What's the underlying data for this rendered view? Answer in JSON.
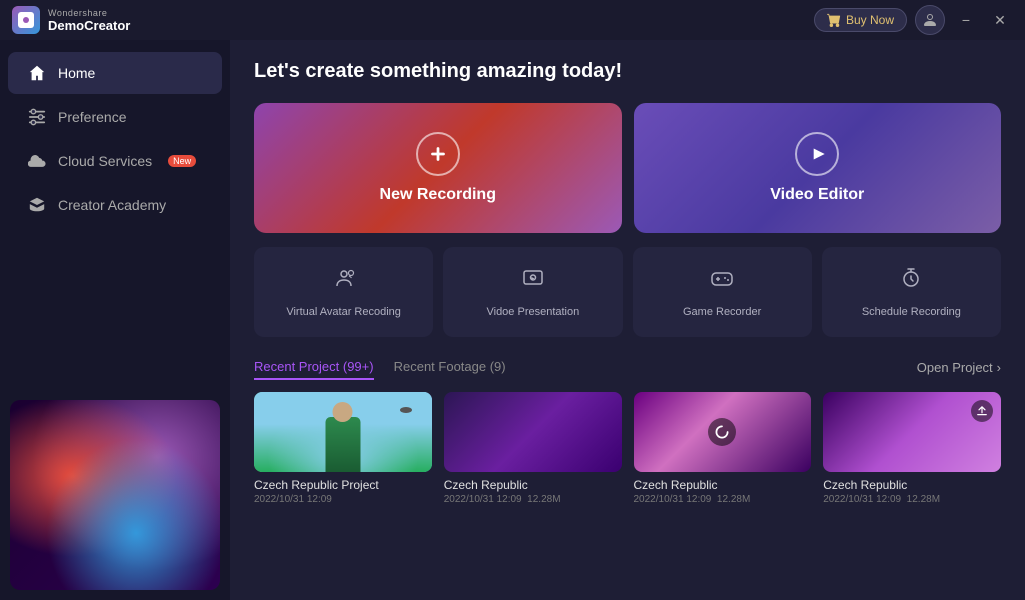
{
  "app": {
    "brand_top": "Wondershare",
    "brand_bottom": "DemoCreator"
  },
  "titlebar": {
    "buy_now_label": "Buy Now",
    "minimize_label": "−",
    "close_label": "✕"
  },
  "sidebar": {
    "items": [
      {
        "id": "home",
        "label": "Home",
        "active": true
      },
      {
        "id": "preference",
        "label": "Preference",
        "active": false
      },
      {
        "id": "cloud-services",
        "label": "Cloud Services",
        "badge": "New",
        "active": false
      },
      {
        "id": "creator-academy",
        "label": "Creator Academy",
        "active": false
      }
    ]
  },
  "content": {
    "headline": "Let's create something amazing today!",
    "cards": [
      {
        "id": "new-recording",
        "label": "New Recording"
      },
      {
        "id": "video-editor",
        "label": "Video Editor"
      }
    ],
    "features": [
      {
        "id": "virtual-avatar",
        "label": "Virtual Avatar Recoding"
      },
      {
        "id": "video-presentation",
        "label": "Vidoe Presentation"
      },
      {
        "id": "game-recorder",
        "label": "Game Recorder"
      },
      {
        "id": "schedule-recording",
        "label": "Schedule Recording"
      }
    ],
    "recent_tabs": [
      {
        "id": "recent-project",
        "label": "Recent Project (99+)",
        "active": true
      },
      {
        "id": "recent-footage",
        "label": "Recent Footage (9)",
        "active": false
      }
    ],
    "open_project_label": "Open Project",
    "projects": [
      {
        "id": "p1",
        "name": "Czech Republic Project",
        "date": "2022/10/31 12:09",
        "size": ""
      },
      {
        "id": "p2",
        "name": "Czech Republic",
        "date": "2022/10/31 12:09",
        "size": "12.28M"
      },
      {
        "id": "p3",
        "name": "Czech Republic",
        "date": "2022/10/31 12:09",
        "size": "12.28M"
      },
      {
        "id": "p4",
        "name": "Czech Republic",
        "date": "2022/10/31 12:09",
        "size": "12.28M"
      }
    ]
  },
  "colors": {
    "accent": "#a855f7",
    "sidebar_bg": "#16162a",
    "content_bg": "#1e1e35",
    "card_bg": "#252540"
  }
}
